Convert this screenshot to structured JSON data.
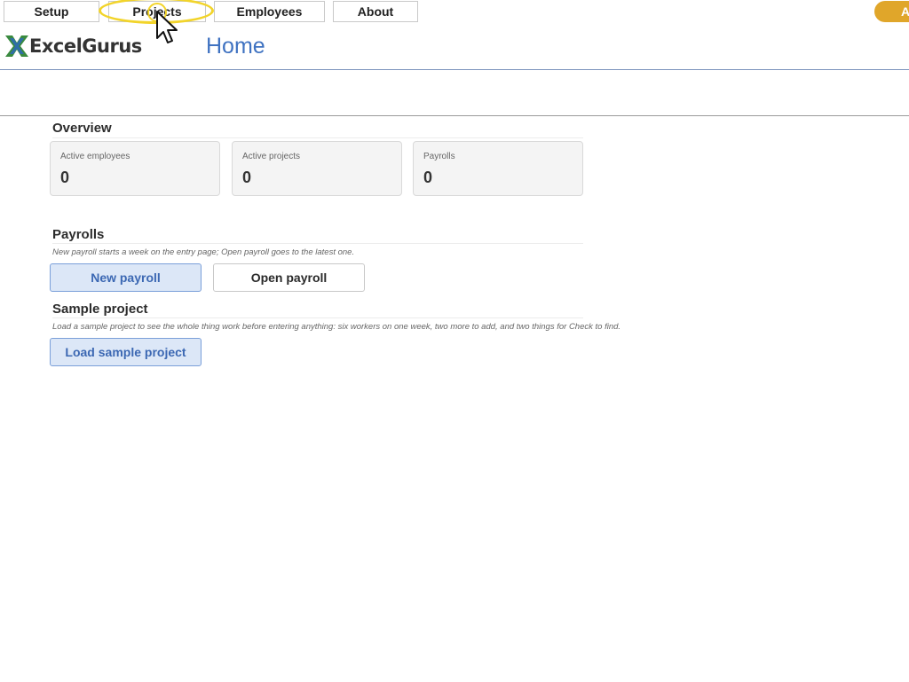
{
  "nav": {
    "setup": "Setup",
    "projects": "Projects",
    "employees": "Employees",
    "about": "About",
    "user_badge": "A"
  },
  "header": {
    "logo_text": "ExcelGurus",
    "title": "Home"
  },
  "overview": {
    "title": "Overview",
    "cards": [
      {
        "label": "Active employees",
        "value": "0"
      },
      {
        "label": "Active projects",
        "value": "0"
      },
      {
        "label": "Payrolls",
        "value": "0"
      }
    ]
  },
  "payrolls": {
    "title": "Payrolls",
    "note": "New payroll starts a week on the entry page; Open payroll goes to the latest one.",
    "new_label": "New payroll",
    "open_label": "Open payroll"
  },
  "sample": {
    "title": "Sample project",
    "note": "Load a sample project to see the whole thing work before entering anything: six workers on one week, two more to add, and two things for Check to find.",
    "load_label": "Load sample project"
  },
  "colors": {
    "accent": "#3f72c1",
    "badge": "#e0a62a",
    "highlight": "#f2d42a",
    "primary_button_bg": "#dce7f7"
  }
}
